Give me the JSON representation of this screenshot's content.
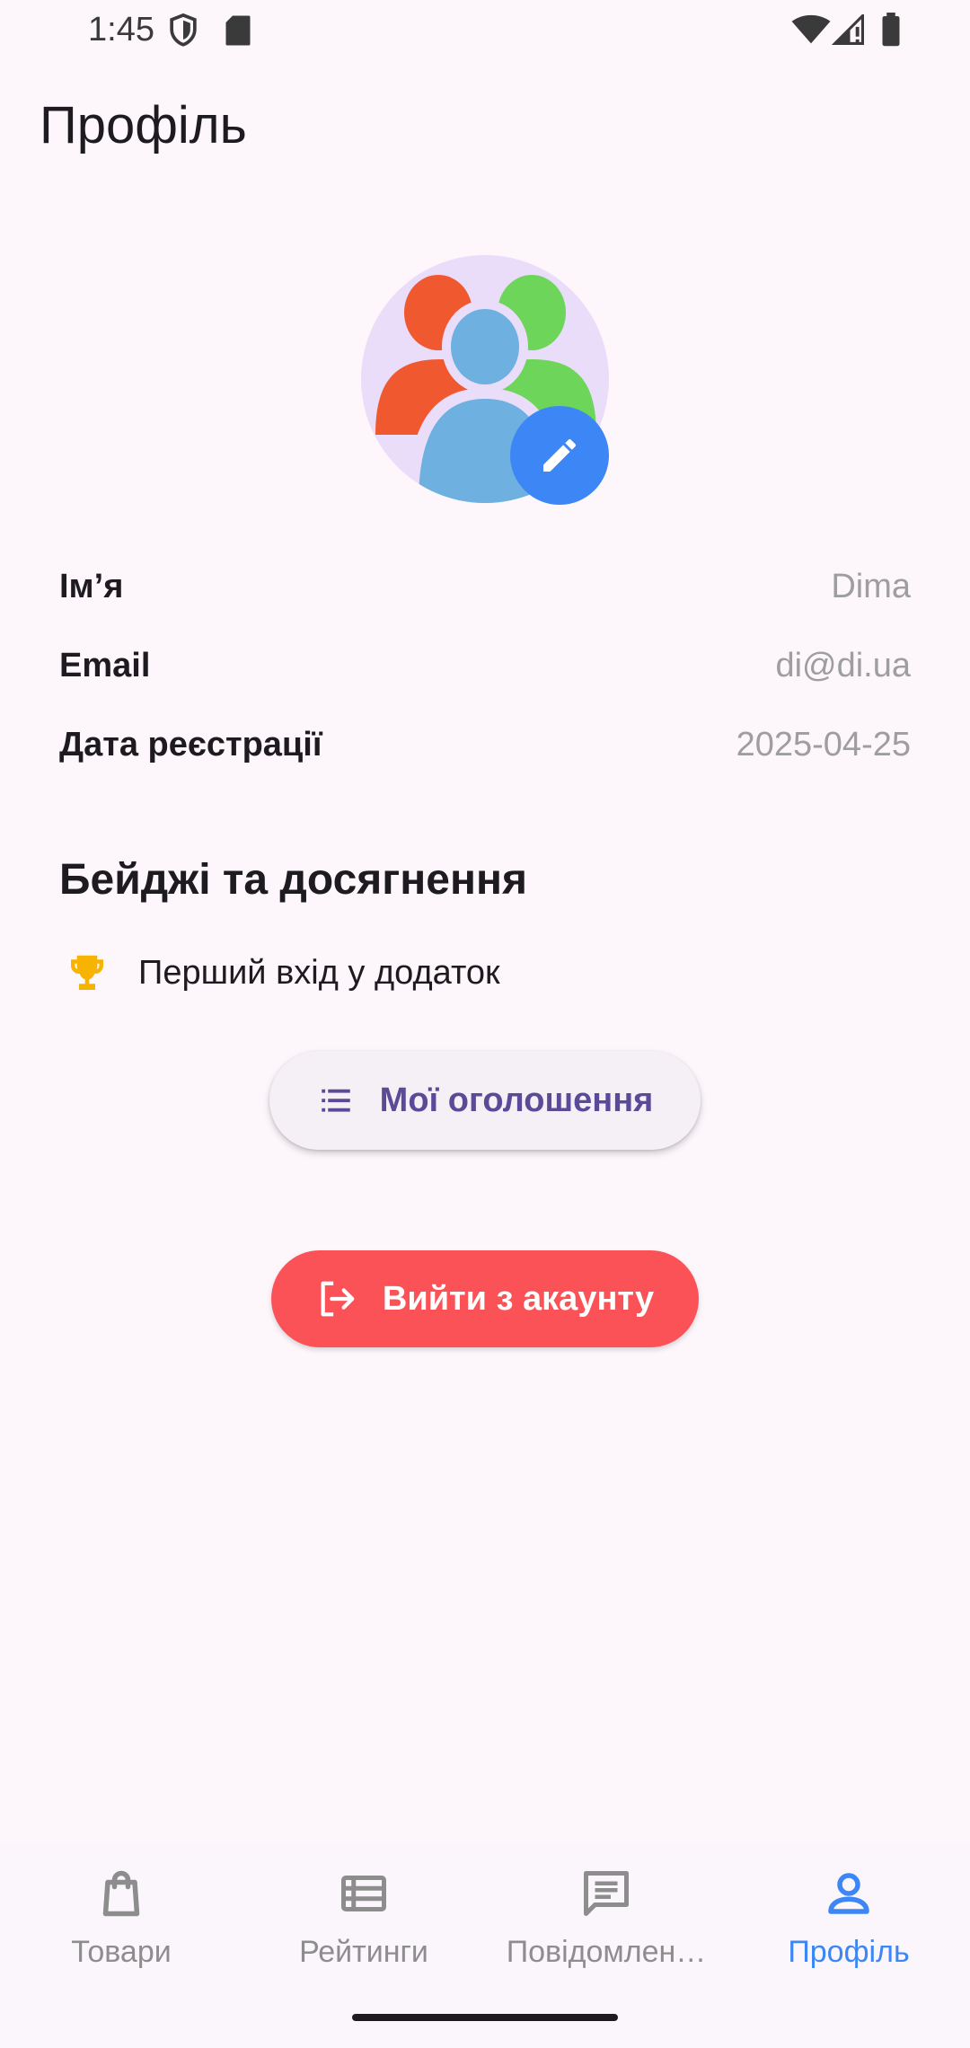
{
  "status_bar": {
    "time": "1:45"
  },
  "header": {
    "title": "Профіль"
  },
  "profile": {
    "rows": [
      {
        "label": "Ім’я",
        "value": "Dima"
      },
      {
        "label": "Email",
        "value": "di@di.ua"
      },
      {
        "label": "Дата реєстрації",
        "value": "2025-04-25"
      }
    ]
  },
  "badges": {
    "title": "Бейджі та досягнення",
    "items": [
      {
        "icon": "trophy-icon",
        "label": "Перший вхід у додаток"
      }
    ]
  },
  "actions": {
    "my_ads_label": "Мої оголошення",
    "logout_label": "Вийти з акаунту"
  },
  "bottom_nav": {
    "items": [
      {
        "label": "Товари",
        "icon": "shopping-bag-icon"
      },
      {
        "label": "Рейтинги",
        "icon": "list-icon"
      },
      {
        "label": "Повідомлен…",
        "icon": "message-icon"
      },
      {
        "label": "Профіль",
        "icon": "person-icon",
        "active": true
      }
    ]
  },
  "colors": {
    "accent": "#3d86f5",
    "logout": "#fb5257",
    "primary_text": "#5b4a98"
  }
}
